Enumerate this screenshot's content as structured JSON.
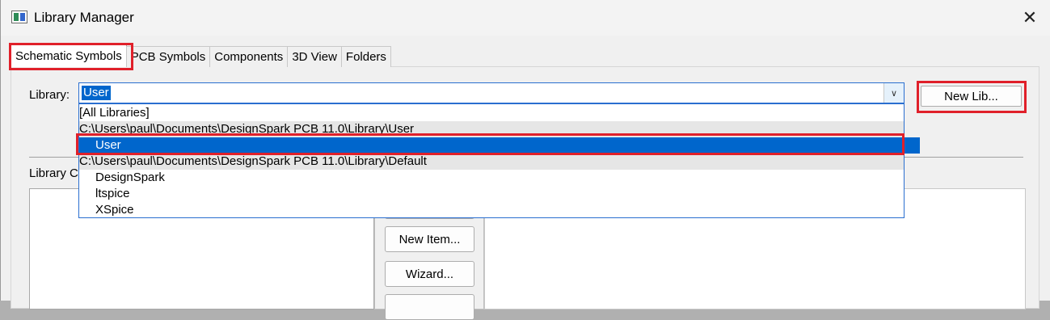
{
  "window": {
    "title": "Library Manager",
    "close_glyph": "✕"
  },
  "tabs": [
    {
      "label": "Schematic Symbols",
      "active": true
    },
    {
      "label": "PCB Symbols",
      "active": false
    },
    {
      "label": "Components",
      "active": false
    },
    {
      "label": "3D View",
      "active": false
    },
    {
      "label": "Folders",
      "active": false
    }
  ],
  "library": {
    "label": "Library:",
    "selected_value": "User",
    "dropdown_arrow": "∨",
    "new_lib_button": "New Lib...",
    "options": [
      {
        "text": "[All Libraries]",
        "kind": "item"
      },
      {
        "text": "C:\\Users\\paul\\Documents\\DesignSpark PCB 11.0\\Library\\User",
        "kind": "group"
      },
      {
        "text": "User",
        "kind": "sub",
        "selected": true
      },
      {
        "text": "C:\\Users\\paul\\Documents\\DesignSpark PCB 11.0\\Library\\Default",
        "kind": "group"
      },
      {
        "text": "DesignSpark",
        "kind": "sub"
      },
      {
        "text": "ltspice",
        "kind": "sub"
      },
      {
        "text": "XSpice",
        "kind": "sub"
      }
    ]
  },
  "contents": {
    "label_visible": "Library C",
    "buttons": {
      "new_item": "New Item...",
      "wizard": "Wizard..."
    }
  },
  "colors": {
    "highlight": "#e0202a",
    "selection": "#0066cc"
  }
}
